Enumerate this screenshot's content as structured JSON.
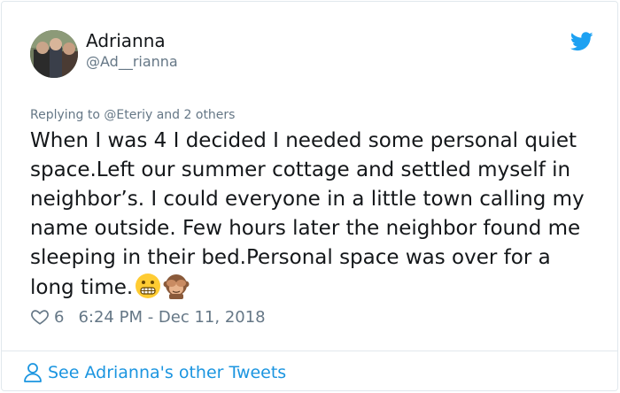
{
  "tweet": {
    "author_name": "Adrianna",
    "author_handle": "@Ad__rianna",
    "reply_prefix": "Replying to ",
    "reply_to": "@Eteriy",
    "reply_suffix": " and 2 others",
    "text": "When I was 4 I decided I needed some personal quiet space.Left our summer cottage and settled myself in neighbor’s. I could everyone in a little town calling my name outside. Few hours later the neighbor found me sleeping in their bed.Personal space was over for a long time.",
    "emojis": [
      "grimacing-face-emoji",
      "see-no-evil-monkey-emoji"
    ],
    "likes": "6",
    "timestamp": "6:24 PM - Dec 11, 2018"
  },
  "footer": {
    "label": "See Adrianna's other Tweets"
  },
  "colors": {
    "twitter_blue": "#1da1f2",
    "link_blue": "#1b95e0",
    "muted": "#657786"
  }
}
